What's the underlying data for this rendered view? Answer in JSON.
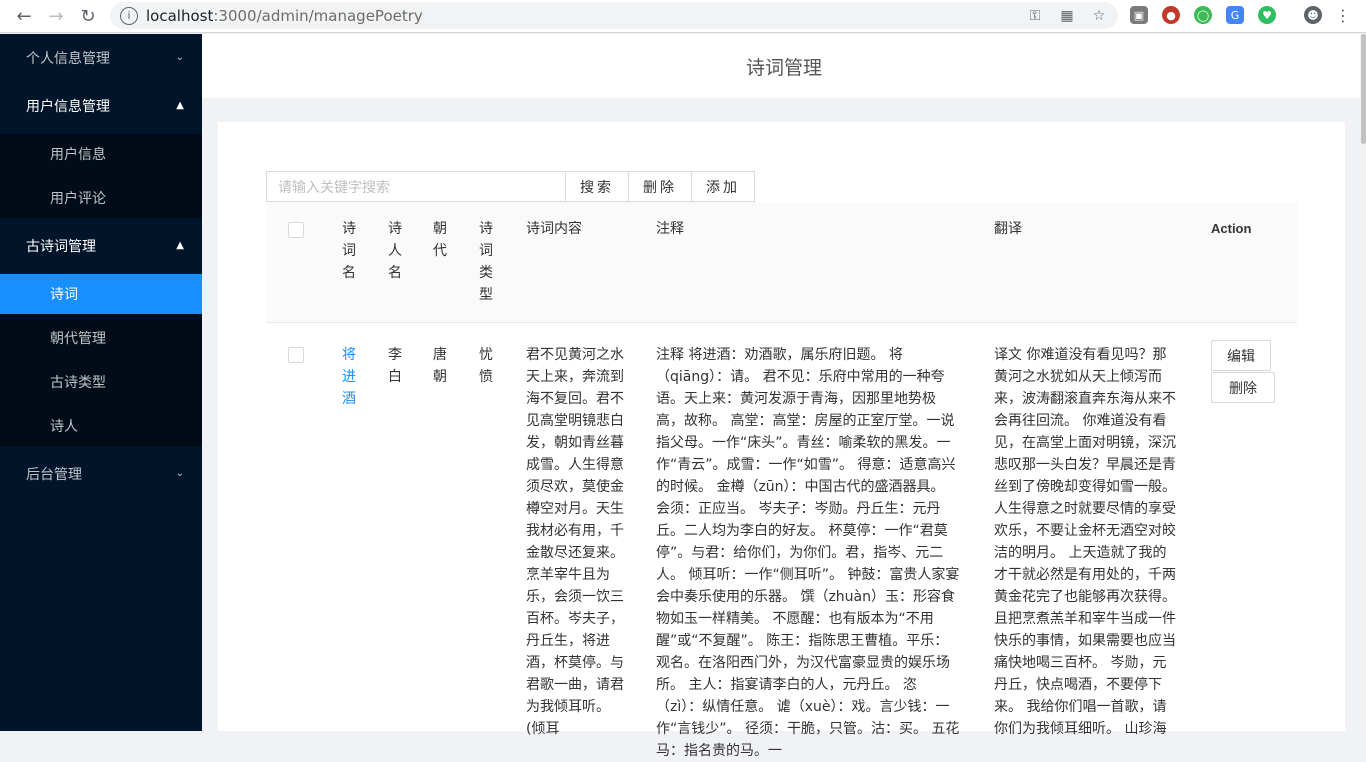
{
  "browser": {
    "url_host": "localhost",
    "url_path": ":3000/admin/managePoetry"
  },
  "sidebar": {
    "groups": [
      {
        "label": "个人信息管理",
        "open": false,
        "items": []
      },
      {
        "label": "用户信息管理",
        "open": true,
        "items": [
          "用户信息",
          "用户评论"
        ]
      },
      {
        "label": "古诗词管理",
        "open": true,
        "items": [
          "诗词",
          "朝代管理",
          "古诗类型",
          "诗人"
        ],
        "active": "诗词"
      },
      {
        "label": "后台管理",
        "open": false,
        "items": []
      }
    ]
  },
  "header": {
    "title": "诗词管理"
  },
  "toolbar": {
    "search_placeholder": "请输入关键字搜索",
    "search_label": "搜索",
    "delete_label": "删除",
    "add_label": "添加"
  },
  "table": {
    "columns": [
      "诗词名",
      "诗人名",
      "朝代",
      "诗词类型",
      "诗词内容",
      "注释",
      "翻译",
      "Action"
    ],
    "rows": [
      {
        "name": "将进酒",
        "poet": "李白",
        "dynasty": "唐朝",
        "type": "忧愤",
        "content": "君不见黄河之水天上来，奔流到海不复回。君不见高堂明镜悲白发，朝如青丝暮成雪。人生得意须尽欢，莫使金樽空对月。天生我材必有用，千金散尽还复来。烹羊宰牛且为乐，会须一饮三百杯。岑夫子，丹丘生，将进酒，杯莫停。与君歌一曲，请君为我倾耳听。(倾耳",
        "notes": "注释 将进酒：劝酒歌，属乐府旧题。 将（qiāng）：请。 君不见：乐府中常用的一种夸语。天上来：黄河发源于青海，因那里地势极高，故称。 高堂：高堂：房屋的正室厅堂。一说指父母。一作“床头”。青丝：喻柔软的黑发。一作“青云”。成雪：一作“如雪”。 得意：适意高兴的时候。 金樽（zūn）：中国古代的盛酒器具。 会须：正应当。 岑夫子：岑勋。丹丘生：元丹丘。二人均为李白的好友。 杯莫停：一作“君莫停”。与君：给你们，为你们。君，指岑、元二人。 倾耳听：一作“侧耳听”。 钟鼓：富贵人家宴会中奏乐使用的乐器。 馔（zhuàn）玉：形容食物如玉一样精美。 不愿醒：也有版本为“不用醒”或“不复醒”。 陈王：指陈思王曹植。平乐：观名。在洛阳西门外，为汉代富豪显贵的娱乐场所。 主人：指宴请李白的人，元丹丘。 恣（zì）：纵情任意。 谑（xuè）：戏。言少钱：一作“言钱少”。 径须：干脆，只管。沽：买。 五花马：指名贵的马。一",
        "translation": "译文 你难道没有看见吗？那黄河之水犹如从天上倾泻而来，波涛翻滚直奔东海从来不会再往回流。 你难道没有看见，在高堂上面对明镜，深沉悲叹那一头白发？早晨还是青丝到了傍晚却变得如雪一般。 人生得意之时就要尽情的享受欢乐，不要让金杯无酒空对皎洁的明月。 上天造就了我的才干就必然是有用处的，千两黄金花完了也能够再次获得。 且把烹煮羔羊和宰牛当成一件快乐的事情，如果需要也应当痛快地喝三百杯。 岑勋，元丹丘，快点喝酒，不要停下来。 我给你们唱一首歌，请你们为我倾耳细听。 山珍海",
        "edit_label": "编辑",
        "delete_label": "删除"
      }
    ]
  }
}
